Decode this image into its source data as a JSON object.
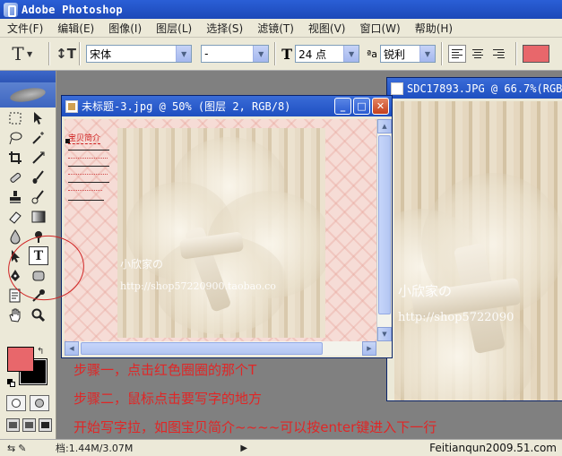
{
  "window": {
    "title": "Adobe Photoshop"
  },
  "menu": [
    "文件(F)",
    "编辑(E)",
    "图像(I)",
    "图层(L)",
    "选择(S)",
    "滤镜(T)",
    "视图(V)",
    "窗口(W)",
    "帮助(H)"
  ],
  "options": {
    "tool_glyph": "T",
    "orient_glyph": "↕T",
    "font_family": "宋体",
    "font_style": "-",
    "size_glyph": "T",
    "font_size": "24 点",
    "aa_glyph": "ªa",
    "antialias": "锐利",
    "text_color": "#e8676b"
  },
  "toolbox": {
    "selected_tool_glyph": "T",
    "foreground_color": "#e8676b",
    "background_color": "#000000"
  },
  "doc1": {
    "title": "未标题-3.jpg @ 50% (图层 2, RGB/8)",
    "canvas_text": "宝贝简介",
    "watermark_name": "小欣家の",
    "watermark_url": "http://shop57220900.taobao.co"
  },
  "doc2": {
    "title": "SDC17893.JPG @ 66.7%(RGB",
    "watermark_name": "小欣家の",
    "watermark_url": "http://shop5722090"
  },
  "instructions": {
    "step1": "步骤一，点击红色圈圈的那个T",
    "step2": "步骤二，鼠标点击要写字的地方",
    "step3": "开始写字拉，如图宝贝简介~~~~可以按enter键进入下一行"
  },
  "status": {
    "doc_size": "档:1.44M/3.07M",
    "site": "Feitianqun2009.51.com"
  }
}
